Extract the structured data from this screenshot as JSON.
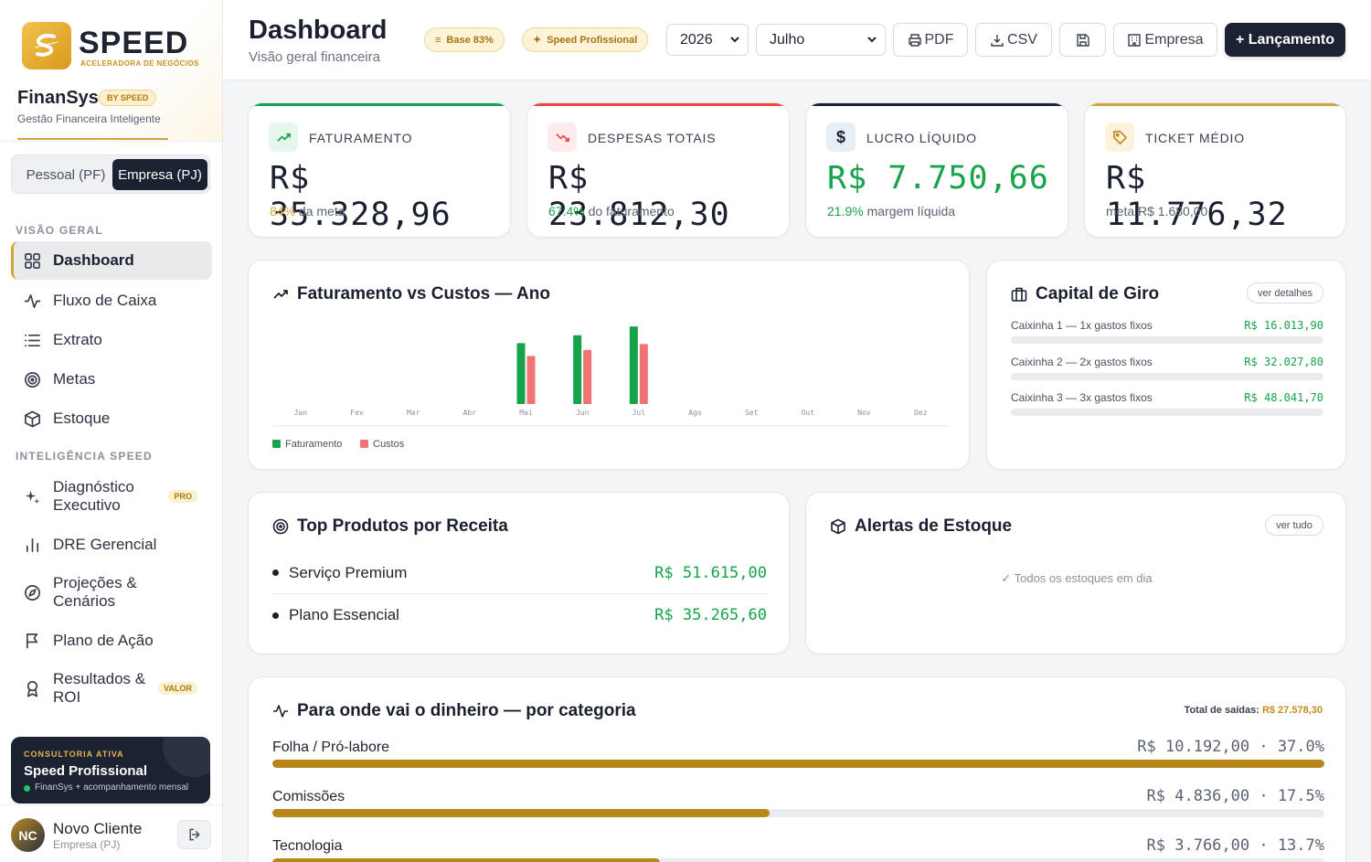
{
  "brand": {
    "logo_word": "SPEED",
    "logo_sub": "ACELERADORA DE NEGÓCIOS",
    "app_name": "FinanSys",
    "by_badge": "BY SPEED",
    "tagline": "Gestão Financeira Inteligente"
  },
  "mode_toggle": {
    "pf": "Pessoal (PF)",
    "pj": "Empresa (PJ)",
    "selected": "pj"
  },
  "sidebar": {
    "section1": "VISÃO GERAL",
    "items1": [
      {
        "label": "Dashboard",
        "icon": "grid-icon",
        "active": true
      },
      {
        "label": "Fluxo de Caixa",
        "icon": "activity-icon"
      },
      {
        "label": "Extrato",
        "icon": "list-icon"
      },
      {
        "label": "Metas",
        "icon": "target-icon"
      },
      {
        "label": "Estoque",
        "icon": "box-icon"
      }
    ],
    "section2": "INTELIGÊNCIA SPEED",
    "items2": [
      {
        "label": "Diagnóstico Executivo",
        "icon": "sparkles-icon",
        "badge": "PRO"
      },
      {
        "label": "DRE Gerencial",
        "icon": "bar-chart-icon"
      },
      {
        "label": "Projeções & Cenários",
        "icon": "compass-icon"
      },
      {
        "label": "Plano de Ação",
        "icon": "flag-icon"
      },
      {
        "label": "Resultados & ROI",
        "icon": "award-icon",
        "badge": "VALOR"
      }
    ]
  },
  "consult": {
    "kicker": "CONSULTORIA ATIVA",
    "title": "Speed Profissional",
    "desc": "FinanSys + acompanhamento mensal"
  },
  "user": {
    "initials": "NC",
    "name": "Novo Cliente",
    "role": "Empresa (PJ)"
  },
  "header": {
    "title": "Dashboard",
    "subtitle": "Visão geral financeira",
    "badge_base": "Base 83%",
    "badge_plan": "Speed Profissional",
    "year": "2026",
    "month": "Julho",
    "btn_pdf": "PDF",
    "btn_csv": "CSV",
    "btn_empresa": "Empresa",
    "btn_new": "+ Lançamento"
  },
  "kpis": [
    {
      "label": "FATURAMENTO",
      "value": "R$ 35.328,96",
      "sub_pct": "84%",
      "sub_text": "da meta",
      "accent": "#16a34a",
      "icon": "trend-up-icon"
    },
    {
      "label": "DESPESAS TOTAIS",
      "value": "R$ 23.812,30",
      "sub_pct": "67.4%",
      "sub_text": "do faturamento",
      "accent": "#ef4444",
      "icon": "trend-down-icon"
    },
    {
      "label": "LUCRO LÍQUIDO",
      "value": "R$ 7.750,66",
      "sub_pct": "21.9%",
      "sub_text": "margem líquida",
      "accent": "#1b2333",
      "icon": "dollar-icon"
    },
    {
      "label": "TICKET MÉDIO",
      "value": "R$ 11.776,32",
      "sub_pct": "",
      "sub_text": "meta R$ 1.680,00",
      "accent": "#d4a53a",
      "icon": "tag-icon"
    }
  ],
  "chart_title": "Faturamento vs Custos — Ano",
  "chart_data": {
    "type": "bar",
    "categories": [
      "Jan",
      "Fev",
      "Mar",
      "Abr",
      "Mai",
      "Jun",
      "Jul",
      "Ago",
      "Set",
      "Out",
      "Nov",
      "Dez"
    ],
    "series": [
      {
        "name": "Faturamento",
        "color": "#16a34a",
        "values": [
          0,
          0,
          0,
          0,
          31000,
          35000,
          39500,
          0,
          0,
          0,
          0,
          0
        ]
      },
      {
        "name": "Custos",
        "color": "#ef7373",
        "values": [
          0,
          0,
          0,
          0,
          24500,
          27500,
          30500,
          0,
          0,
          0,
          0,
          0
        ]
      }
    ],
    "ylim": [
      0,
      40000
    ],
    "legend": "bottom-left",
    "grid": false
  },
  "capital_giro": {
    "title": "Capital de Giro",
    "button": "ver detalhes",
    "rows": [
      {
        "label": "Caixinha 1 — 1x gastos fixos",
        "value": "R$ 16.013,90"
      },
      {
        "label": "Caixinha 2 — 2x gastos fixos",
        "value": "R$ 32.027,80"
      },
      {
        "label": "Caixinha 3 — 3x gastos fixos",
        "value": "R$ 48.041,70"
      }
    ]
  },
  "top_produtos": {
    "title": "Top Produtos por Receita",
    "rows": [
      {
        "name": "Serviço Premium",
        "value": "R$ 51.615,00"
      },
      {
        "name": "Plano Essencial",
        "value": "R$ 35.265,60"
      }
    ]
  },
  "alertas": {
    "title": "Alertas de Estoque",
    "button": "ver tudo",
    "message": "✓ Todos os estoques em dia"
  },
  "categorias": {
    "title": "Para onde vai o dinheiro — por categoria",
    "total_label": "Total de saídas:",
    "total_value": "R$ 27.578,30",
    "rows": [
      {
        "label": "Folha / Pró-labore",
        "value": "R$ 10.192,00 · 37.0%",
        "pct": 100
      },
      {
        "label": "Comissões",
        "value": "R$ 4.836,00 · 17.5%",
        "pct": 47.3
      },
      {
        "label": "Tecnologia",
        "value": "R$ 3.766,00 · 13.7%",
        "pct": 36.8
      }
    ]
  }
}
